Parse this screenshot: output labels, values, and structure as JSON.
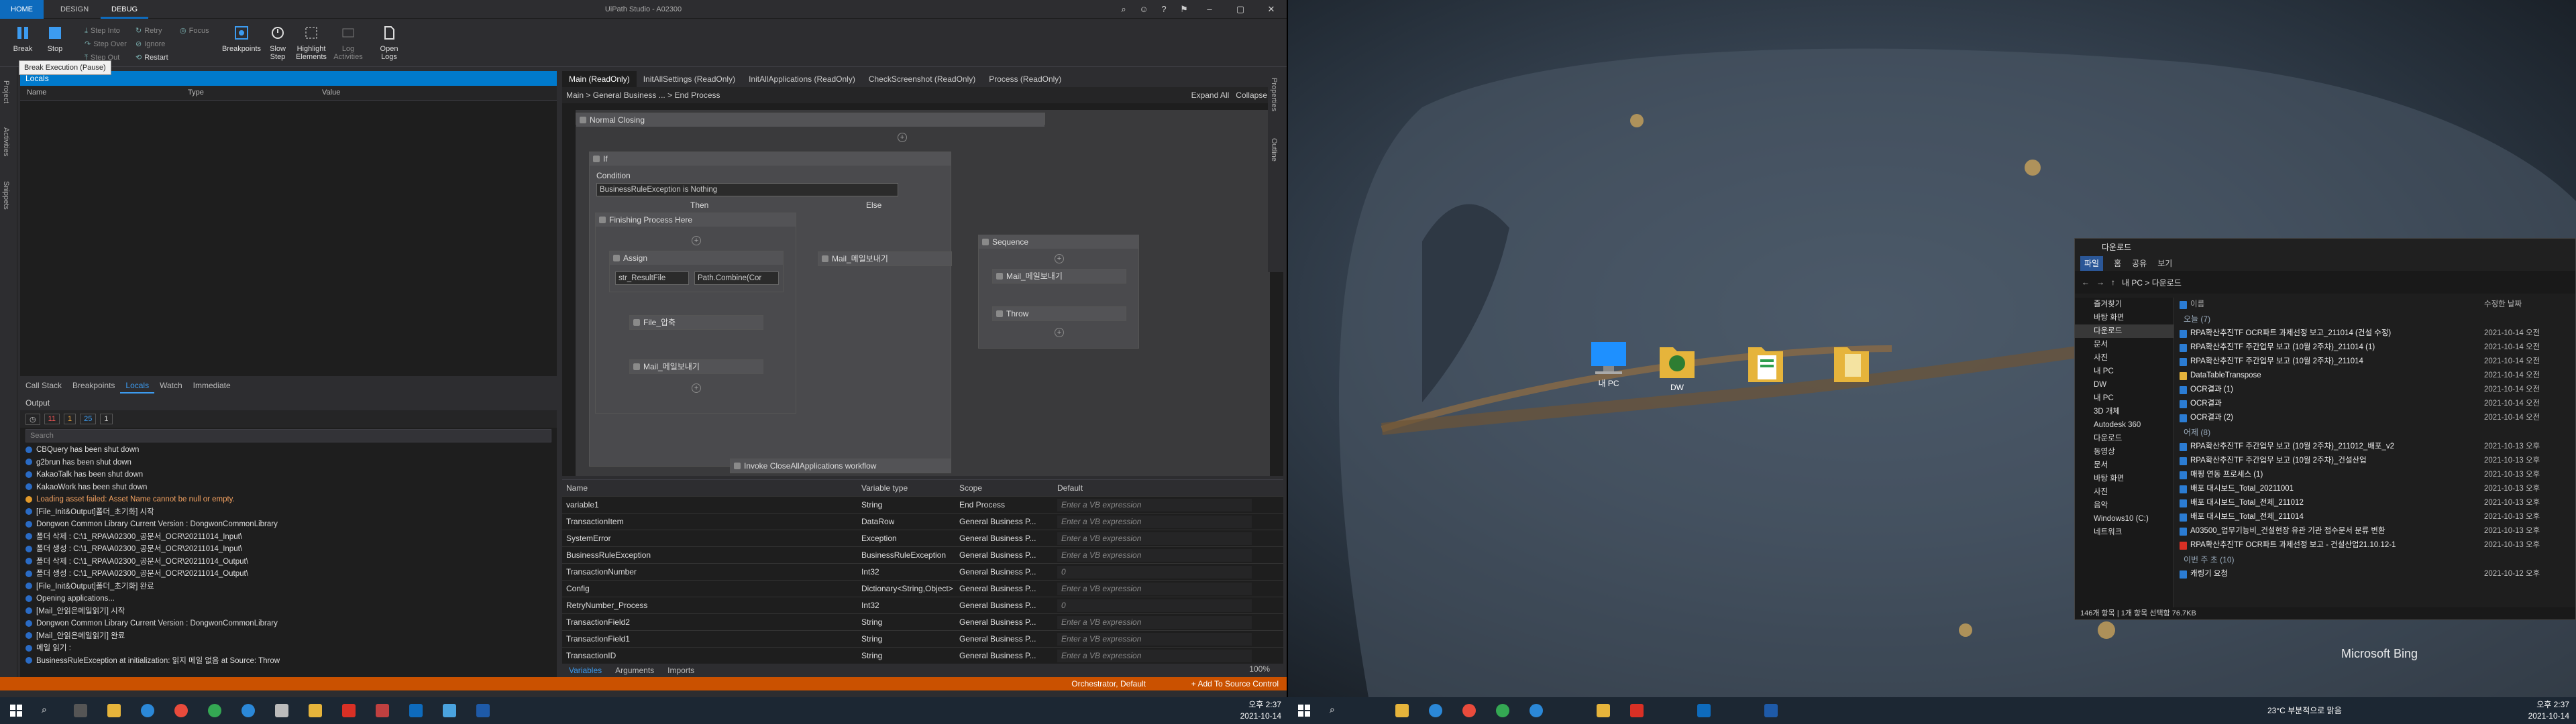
{
  "uipath": {
    "tabs": [
      "HOME",
      "DESIGN",
      "DEBUG"
    ],
    "window_title": "UiPath Studio - A02300",
    "ribbon": {
      "break": "Break",
      "stop": "Stop",
      "step_into": "Step Into",
      "step_over": "Step Over",
      "step_out": "Step Out",
      "retry": "Retry",
      "ignore": "Ignore",
      "restart": "Restart",
      "focus": "Focus",
      "breakpoints": "Breakpoints",
      "slow_step": "Slow Step",
      "highlight_elements": "Highlight Elements",
      "log_activities": "Log Activities",
      "open_logs": "Open Logs"
    },
    "tooltip": "Break Execution (Pause)",
    "left_rail": [
      "Project",
      "Activities",
      "Snippets"
    ],
    "locals": {
      "title": "Locals",
      "columns": [
        "Name",
        "Type",
        "Value"
      ]
    },
    "debug_tabs": [
      "Call Stack",
      "Breakpoints",
      "Locals",
      "Watch",
      "Immediate"
    ],
    "output": {
      "title": "Output",
      "counts": [
        "11",
        "1",
        "25",
        "1"
      ],
      "search_placeholder": "Search",
      "lines": [
        {
          "t": "CBQuery has been shut down",
          "err": false
        },
        {
          "t": "g2brun has been shut down",
          "err": false
        },
        {
          "t": "KakaoTalk has been shut down",
          "err": false
        },
        {
          "t": "KakaoWork has been shut down",
          "err": false
        },
        {
          "t": "Loading asset failed: Asset Name cannot be null or empty.",
          "err": true
        },
        {
          "t": "[File_Init&Output]폴더_초기화] 시작",
          "err": false
        },
        {
          "t": "Dongwon Common Library Current Version : DongwonCommonLibrary",
          "err": false
        },
        {
          "t": "폴더 삭제 : C:\\1_RPA\\A02300_공문서_OCR\\20211014_Input\\",
          "err": false
        },
        {
          "t": "폴더 생성 : C:\\1_RPA\\A02300_공문서_OCR\\20211014_Input\\",
          "err": false
        },
        {
          "t": "폴더 삭제 : C:\\1_RPA\\A02300_공문서_OCR\\20211014_Output\\",
          "err": false
        },
        {
          "t": "폴더 생성 : C:\\1_RPA\\A02300_공문서_OCR\\20211014_Output\\",
          "err": false
        },
        {
          "t": "[File_Init&Output]폴더_초기화] 완료",
          "err": false
        },
        {
          "t": "Opening applications...",
          "err": false
        },
        {
          "t": "[Mail_안읽은메일읽기] 시작",
          "err": false
        },
        {
          "t": "Dongwon Common Library Current Version : DongwonCommonLibrary",
          "err": false
        },
        {
          "t": "[Mail_안읽은메일읽기] 완료",
          "err": false
        },
        {
          "t": "메일 읽기 :",
          "err": false
        },
        {
          "t": "BusinessRuleException at initialization: 읽지 메일 없음 at Source: Throw",
          "err": false
        }
      ]
    },
    "doc_tabs": [
      "Main (ReadOnly)",
      "InitAllSettings (ReadOnly)",
      "InitAllApplications (ReadOnly)",
      "CheckScreenshot (ReadOnly)",
      "Process (ReadOnly)"
    ],
    "breadcrumb": [
      "Main",
      "General Business ...",
      "End Process"
    ],
    "expand_all": "Expand All",
    "collapse_all": "Collapse All",
    "right_rail": [
      "Properties",
      "Outline"
    ],
    "workflow": {
      "normal_closing": "Normal Closing",
      "if_title": "If",
      "condition_label": "Condition",
      "condition_value": "BusinessRuleException is Nothing",
      "then": "Then",
      "else": "Else",
      "finishing": "Finishing Process Here",
      "assign": "Assign",
      "assign_to": "str_ResultFile",
      "assign_value": "Path.Combine(Cor",
      "file_zip": "File_압축",
      "mail_send": "Mail_메일보내기",
      "mail_send_else": "Mail_메일보내기",
      "sequence": "Sequence",
      "mail_send_seq": "Mail_메일보내기",
      "throw": "Throw",
      "invoke": "Invoke CloseAllApplications workflow"
    },
    "variables": {
      "columns": [
        "Name",
        "Variable type",
        "Scope",
        "Default"
      ],
      "rows": [
        {
          "name": "variable1",
          "type": "String",
          "scope": "End Process",
          "def": "Enter a VB expression"
        },
        {
          "name": "TransactionItem",
          "type": "DataRow",
          "scope": "General Business P...",
          "def": "Enter a VB expression"
        },
        {
          "name": "SystemError",
          "type": "Exception",
          "scope": "General Business P...",
          "def": "Enter a VB expression"
        },
        {
          "name": "BusinessRuleException",
          "type": "BusinessRuleException",
          "scope": "General Business P...",
          "def": "Enter a VB expression"
        },
        {
          "name": "TransactionNumber",
          "type": "Int32",
          "scope": "General Business P...",
          "def": "0"
        },
        {
          "name": "Config",
          "type": "Dictionary<String,Object>",
          "scope": "General Business P...",
          "def": "Enter a VB expression"
        },
        {
          "name": "RetryNumber_Process",
          "type": "Int32",
          "scope": "General Business P...",
          "def": "0"
        },
        {
          "name": "TransactionField2",
          "type": "String",
          "scope": "General Business P...",
          "def": "Enter a VB expression"
        },
        {
          "name": "TransactionField1",
          "type": "String",
          "scope": "General Business P...",
          "def": "Enter a VB expression"
        },
        {
          "name": "TransactionID",
          "type": "String",
          "scope": "General Business P...",
          "def": "Enter a VB expression"
        }
      ],
      "tabs": [
        "Variables",
        "Arguments",
        "Imports"
      ],
      "zoom": "100%"
    },
    "status": {
      "orchestrator": "Orchestrator, Default",
      "source_control": "+ Add To Source Control"
    }
  },
  "desktop": {
    "icons": [
      "내 PC",
      "DW",
      "",
      ""
    ],
    "explorer": {
      "title": "다운로드",
      "ribbon": [
        "파일",
        "홈",
        "공유",
        "보기"
      ],
      "address": "내 PC > 다운로드",
      "nav": [
        "즐겨찾기",
        "바탕 화면",
        "다운로드",
        "문서",
        "사진",
        "내 PC",
        "DW",
        "내 PC",
        "3D 개체",
        "Autodesk 360",
        "다운로드",
        "동영상",
        "문서",
        "바탕 화면",
        "사진",
        "음악",
        "Windows10 (C:)",
        "네트워크"
      ],
      "col_name": "이름",
      "col_date": "수정한 날짜",
      "groups": [
        {
          "label": "오늘 (7)",
          "rows": [
            {
              "n": "RPA확산추진TF OCR파트 과제선정 보고_211014 (건설 수정)",
              "d": "2021-10-14 오전",
              "k": "doc"
            },
            {
              "n": "RPA확산추진TF 주간업무 보고 (10월 2주차)_211014 (1)",
              "d": "2021-10-14 오전",
              "k": "doc"
            },
            {
              "n": "RPA확산추진TF 주간업무 보고 (10월 2주차)_211014",
              "d": "2021-10-14 오전",
              "k": "doc"
            },
            {
              "n": "DataTableTranspose",
              "d": "2021-10-14 오전",
              "k": "fold"
            },
            {
              "n": "OCR결과 (1)",
              "d": "2021-10-14 오전",
              "k": "doc"
            },
            {
              "n": "OCR결과",
              "d": "2021-10-14 오전",
              "k": "doc"
            },
            {
              "n": "OCR결과 (2)",
              "d": "2021-10-14 오전",
              "k": "doc"
            }
          ]
        },
        {
          "label": "어제 (8)",
          "rows": [
            {
              "n": "RPA확산추진TF 주간업무 보고 (10월 2주차)_211012_배포_v2",
              "d": "2021-10-13 오후",
              "k": "doc"
            },
            {
              "n": "RPA확산추진TF 주간업무 보고 (10월 2주차)_건설산업",
              "d": "2021-10-13 오후",
              "k": "doc"
            },
            {
              "n": "매핑 연동 프로세스 (1)",
              "d": "2021-10-13 오후",
              "k": "doc"
            },
            {
              "n": "배포 대시보드_Total_20211001",
              "d": "2021-10-13 오후",
              "k": "doc"
            },
            {
              "n": "배포 대시보드_Total_전체_211012",
              "d": "2021-10-13 오후",
              "k": "doc"
            },
            {
              "n": "배포 대시보드_Total_전체_211014",
              "d": "2021-10-13 오후",
              "k": "doc"
            },
            {
              "n": "A03500_업무기능비_건설현장 유관 기관 접수문서 분류 변환",
              "d": "2021-10-13 오후",
              "k": "doc"
            },
            {
              "n": "RPA확산추진TF OCR파트 과제선정 보고 - 건설산업21.10.12-1",
              "d": "2021-10-13 오후",
              "k": "pdf"
            }
          ]
        },
        {
          "label": "이번 주 초 (10)",
          "rows": [
            {
              "n": "캐링기 요청",
              "d": "2021-10-12 오후",
              "k": "doc"
            }
          ]
        }
      ],
      "status": "146개 항목  |  1개 항목 선택함 76.7KB"
    },
    "watermark": "Microsoft Bing"
  },
  "taskbar": {
    "left_time": "오후 2:37",
    "left_date": "2021-10-14",
    "right_weather": "23°C 부분적으로 맑음",
    "right_time": "오후 2:37",
    "right_date": "2021-10-14"
  }
}
